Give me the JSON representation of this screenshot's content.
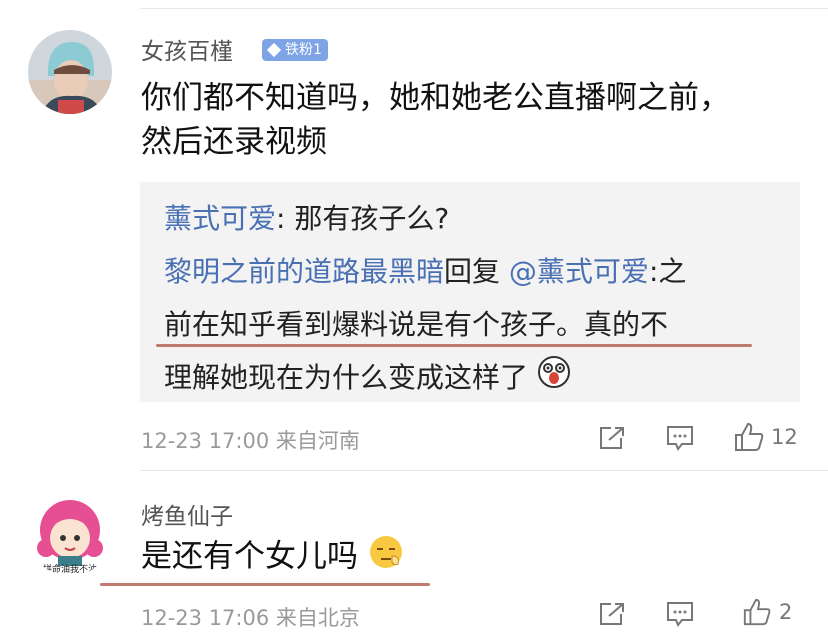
{
  "comment1": {
    "username": "女孩百槿",
    "badge": "铁粉1",
    "text_line1": "你们都不知道吗，她和她老公直播啊之前，",
    "text_line2": "然后还录视频",
    "replies": {
      "r1_user": "薰式可爱",
      "r1_text": ": 那有孩子么?",
      "r2_user": "黎明之前的道路最黑暗",
      "r2_mid": "回复 ",
      "r2_mention": "@薰式可爱",
      "r2_text_a": ":之",
      "r2_line2": "前在知乎看到爆料说是有个孩子。真的不",
      "r2_line3": "理解她现在为什么变成这样了"
    },
    "meta": "12-23 17:00 来自河南",
    "like_count": "12"
  },
  "comment2": {
    "username": "烤鱼仙子",
    "text": "是还有个女儿吗",
    "avatar_caption": "拼命油我不油",
    "meta": "12-23 17:06 来自北京",
    "like_count": "2"
  },
  "colors": {
    "link": "#4a70b4",
    "badge": "#7fa4e6",
    "underline": "#b46454"
  }
}
